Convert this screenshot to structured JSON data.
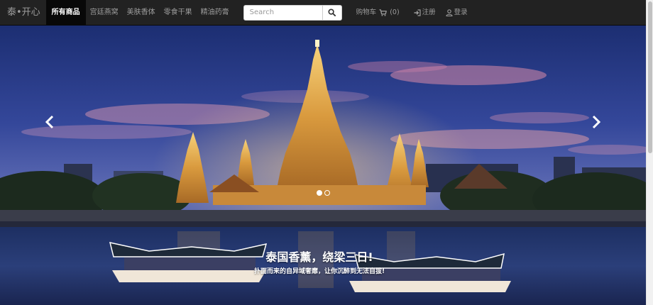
{
  "navbar": {
    "brand": "泰•开心",
    "categories": [
      {
        "label": "所有商品",
        "active": true
      },
      {
        "label": "宫廷燕窝",
        "active": false
      },
      {
        "label": "美肤香体",
        "active": false
      },
      {
        "label": "零食干果",
        "active": false
      },
      {
        "label": "精油药膏",
        "active": false
      }
    ],
    "search": {
      "placeholder": "Search",
      "value": "",
      "button_icon": "search-icon"
    },
    "cart": {
      "label": "购物车",
      "count_text": "(0)",
      "icon": "shopping-cart-icon"
    },
    "register": {
      "label": "注册",
      "icon": "sign-in-icon"
    },
    "login": {
      "label": "登录",
      "icon": "user-icon"
    }
  },
  "carousel": {
    "slide_count": 2,
    "active_index": 0,
    "caption_title": "泰国香薰，绕梁三日!",
    "caption_text": "扑面而来的自异域奢靡，让你沉醉到无法自拔!",
    "prev_icon": "chevron-left-icon",
    "next_icon": "chevron-right-icon"
  },
  "colors": {
    "navbar_bg": "#222222",
    "nav_text": "#9d9d9d",
    "nav_active_bg": "#080808",
    "nav_active_text": "#ffffff"
  }
}
